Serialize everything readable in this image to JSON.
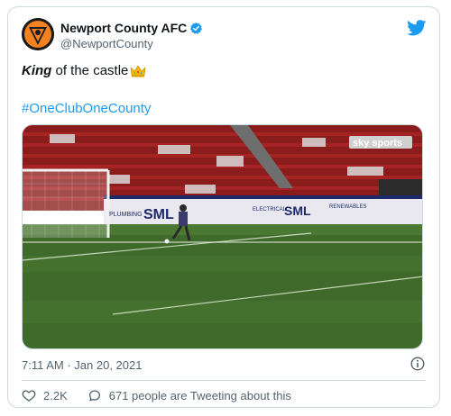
{
  "tweet": {
    "display_name": "Newport County AFC",
    "handle": "@NewportCounty",
    "text_bold": "King",
    "text_rest": " of the castle",
    "hashtag": "#OneClubOneCounty",
    "timestamp": "7:11 AM · Jan 20, 2021",
    "likes": "2.2K",
    "tweeting_text": "671 people are Tweeting about this"
  },
  "media": {
    "broadcaster_logo_text": "sky sports",
    "ad_boards": [
      "PLUMBING",
      "SML",
      "ELECTRICAL",
      "SML",
      "RENEWABLES"
    ]
  },
  "colors": {
    "accent": "#1d9bf0",
    "text": "#0f1419",
    "muted": "#536471",
    "border": "#cfd9de"
  },
  "icons": {
    "verified": "verified-badge-icon",
    "twitter": "twitter-bird-icon",
    "like": "heart-icon",
    "reply": "speech-bubble-icon",
    "info": "info-icon",
    "emoji": "crown-emoji-icon"
  }
}
